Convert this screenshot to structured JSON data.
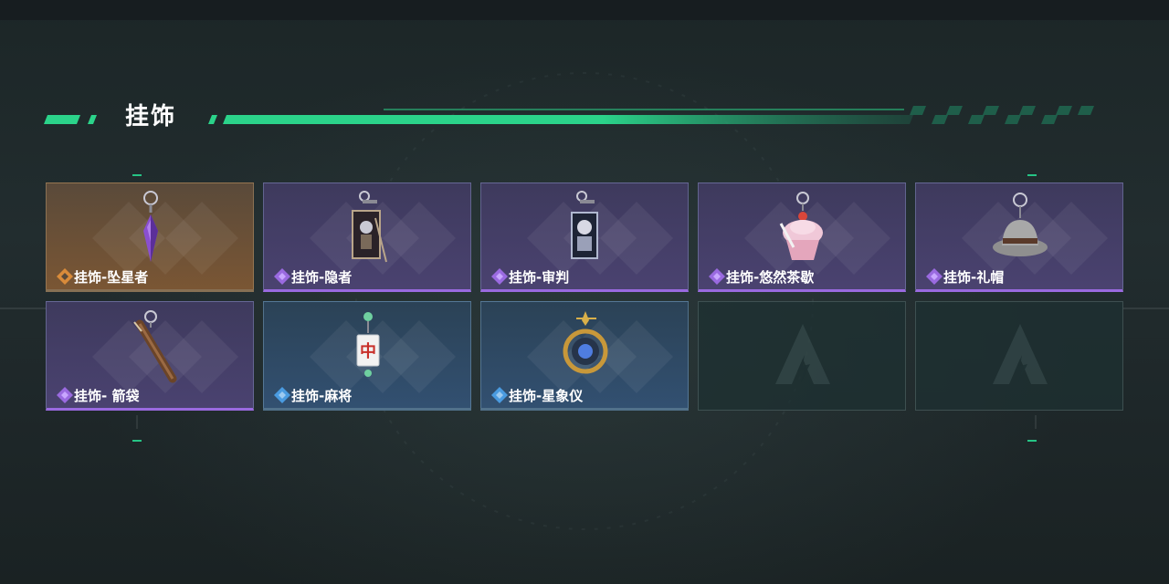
{
  "header": {
    "title": "挂饰"
  },
  "colors": {
    "accent": "#2bd38a",
    "purple": "#9a6ae0",
    "orange": "#d98b3a",
    "blue": "#4a9be0"
  },
  "items": [
    {
      "label": "挂饰-坠星者",
      "rarity": "orange",
      "icon": "purple-crystal-pendant-icon"
    },
    {
      "label": "挂饰-隐者",
      "rarity": "purple",
      "icon": "tarot-card-hermit-icon"
    },
    {
      "label": "挂饰-审判",
      "rarity": "purple",
      "icon": "tarot-card-judgement-icon"
    },
    {
      "label": "挂饰-悠然茶歇",
      "rarity": "purple",
      "icon": "cupcake-icon"
    },
    {
      "label": "挂饰-礼帽",
      "rarity": "purple",
      "icon": "fedora-hat-icon"
    },
    {
      "label": "挂饰- 箭袋",
      "rarity": "purple",
      "icon": "quiver-icon"
    },
    {
      "label": "挂饰-麻将",
      "rarity": "blue",
      "icon": "mahjong-tile-icon"
    },
    {
      "label": "挂饰-星象仪",
      "rarity": "blue",
      "icon": "astrolabe-icon"
    }
  ],
  "empty_slots": 2
}
